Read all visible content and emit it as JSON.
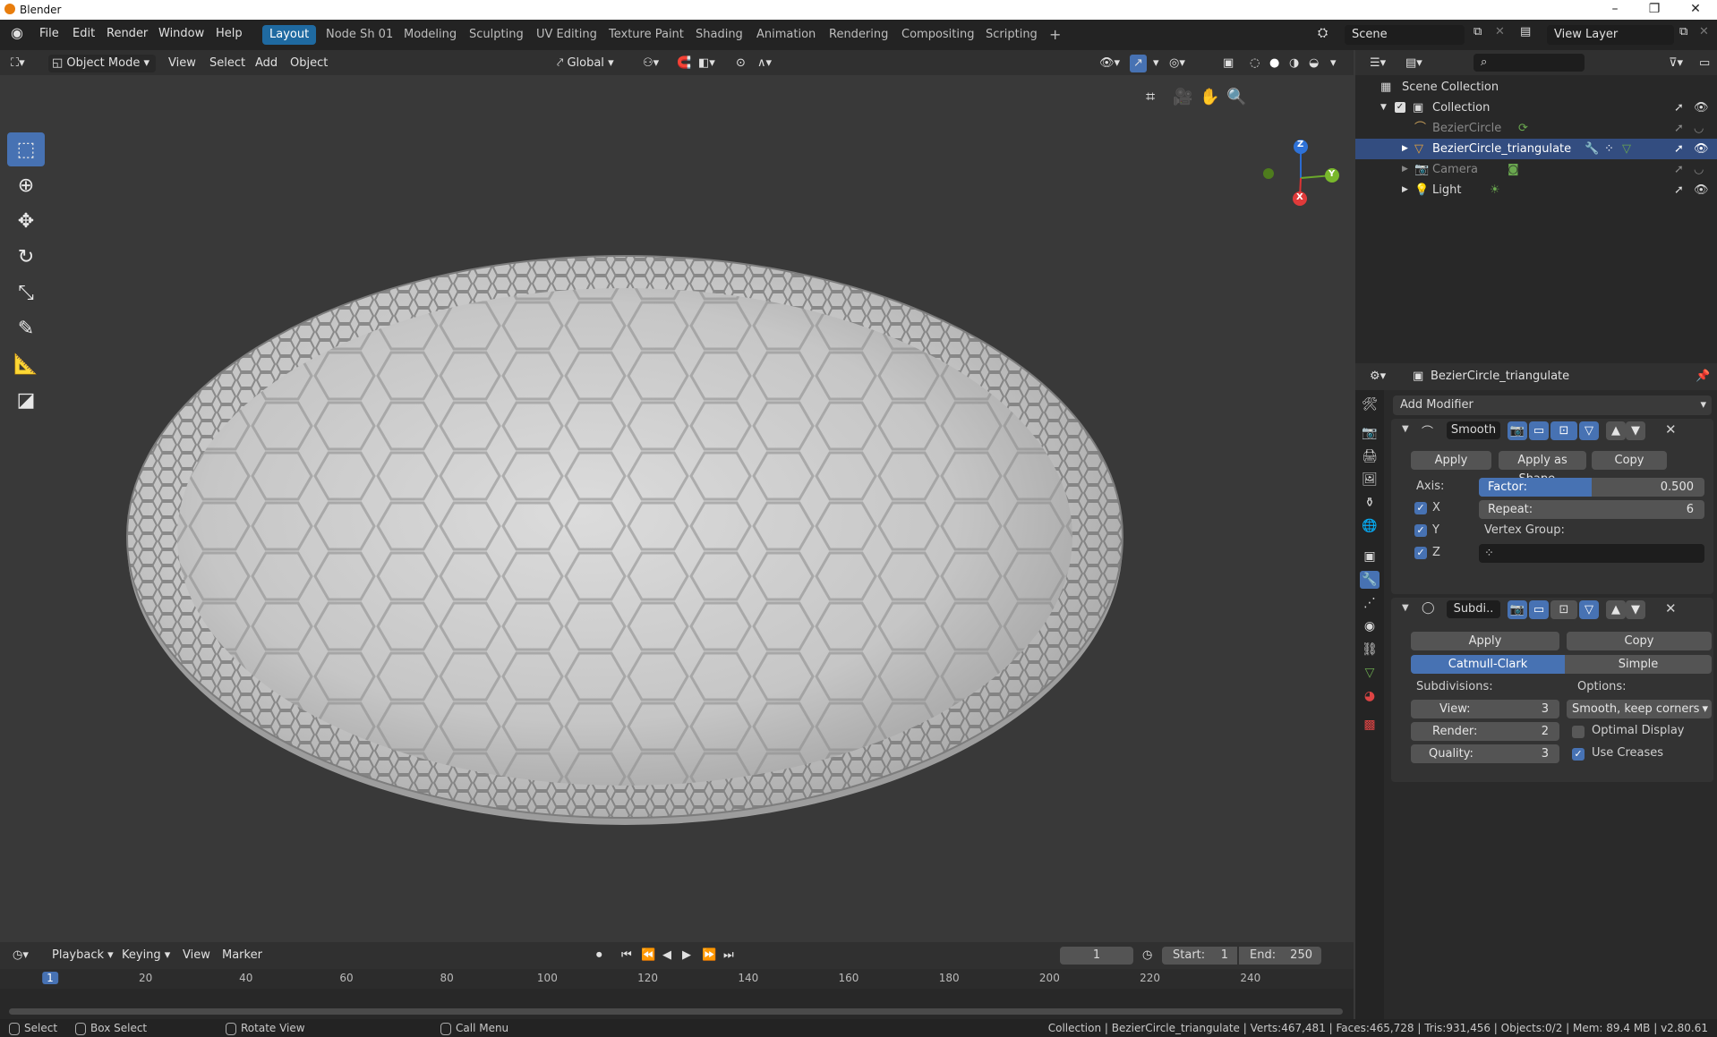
{
  "app": {
    "title": "Blender"
  },
  "menus": [
    "File",
    "Edit",
    "Render",
    "Window",
    "Help"
  ],
  "workspaces": [
    {
      "label": "Layout",
      "active": true
    },
    {
      "label": "Node Sh 01"
    },
    {
      "label": "Modeling"
    },
    {
      "label": "Sculpting"
    },
    {
      "label": "UV Editing"
    },
    {
      "label": "Texture Paint"
    },
    {
      "label": "Shading"
    },
    {
      "label": "Animation"
    },
    {
      "label": "Rendering"
    },
    {
      "label": "Compositing"
    },
    {
      "label": "Scripting"
    }
  ],
  "add_workspace": "+",
  "scene": {
    "name": "Scene",
    "view_layer": "View Layer"
  },
  "viewport_header": {
    "mode": "Object Mode",
    "view": "View",
    "select": "Select",
    "add": "Add",
    "object": "Object",
    "orientation": "Global"
  },
  "gizmo": {
    "z": "Z",
    "y": "Y",
    "x": "X"
  },
  "outliner": {
    "root": "Scene Collection",
    "items": [
      {
        "label": "Collection",
        "level": 1,
        "dim": false
      },
      {
        "label": "BezierCircle",
        "level": 2,
        "dim": true
      },
      {
        "label": "BezierCircle_triangulate",
        "level": 2,
        "dim": false,
        "selected": true
      },
      {
        "label": "Camera",
        "level": 2,
        "dim": true
      },
      {
        "label": "Light",
        "level": 2,
        "dim": false
      }
    ]
  },
  "properties": {
    "object_name": "BezierCircle_triangulate",
    "add_modifier": "Add Modifier",
    "smooth": {
      "name": "Smooth",
      "apply": "Apply",
      "apply_shape": "Apply as Shape ..",
      "copy": "Copy",
      "axis_label": "Axis:",
      "x": "X",
      "y": "Y",
      "z": "Z",
      "factor_label": "Factor:",
      "factor_value": "0.500",
      "factor_fraction": 0.5,
      "repeat_label": "Repeat:",
      "repeat_value": "6",
      "vertex_group": "Vertex Group:"
    },
    "subdiv": {
      "name": "Subdi..",
      "apply": "Apply",
      "copy": "Copy",
      "catmull": "Catmull-Clark",
      "simple": "Simple",
      "subdivisions": "Subdivisions:",
      "options": "Options:",
      "view_label": "View:",
      "view_value": "3",
      "render_label": "Render:",
      "render_value": "2",
      "quality_label": "Quality:",
      "quality_value": "3",
      "uv_smooth": "Smooth, keep corners",
      "optimal": "Optimal Display",
      "creases": "Use Creases"
    }
  },
  "timeline": {
    "playback": "Playback",
    "keying": "Keying",
    "view": "View",
    "marker": "Marker",
    "current_frame": "1",
    "start_label": "Start:",
    "start": "1",
    "end_label": "End:",
    "end": "250",
    "ruler": [
      "1",
      "20",
      "40",
      "60",
      "80",
      "100",
      "120",
      "140",
      "160",
      "180",
      "200",
      "220",
      "240"
    ]
  },
  "statusbar": {
    "select": "Select",
    "box_select": "Box Select",
    "rotate": "Rotate View",
    "call_menu": "Call Menu",
    "info": "Collection | BezierCircle_triangulate | Verts:467,481 | Faces:465,728 | Tris:931,456 | Objects:0/2 | Mem: 89.4 MB | v2.80.61"
  },
  "colors": {
    "accent": "#4772b3",
    "workspace_active": "#1f6aa1",
    "brand": "#e87d0d"
  }
}
